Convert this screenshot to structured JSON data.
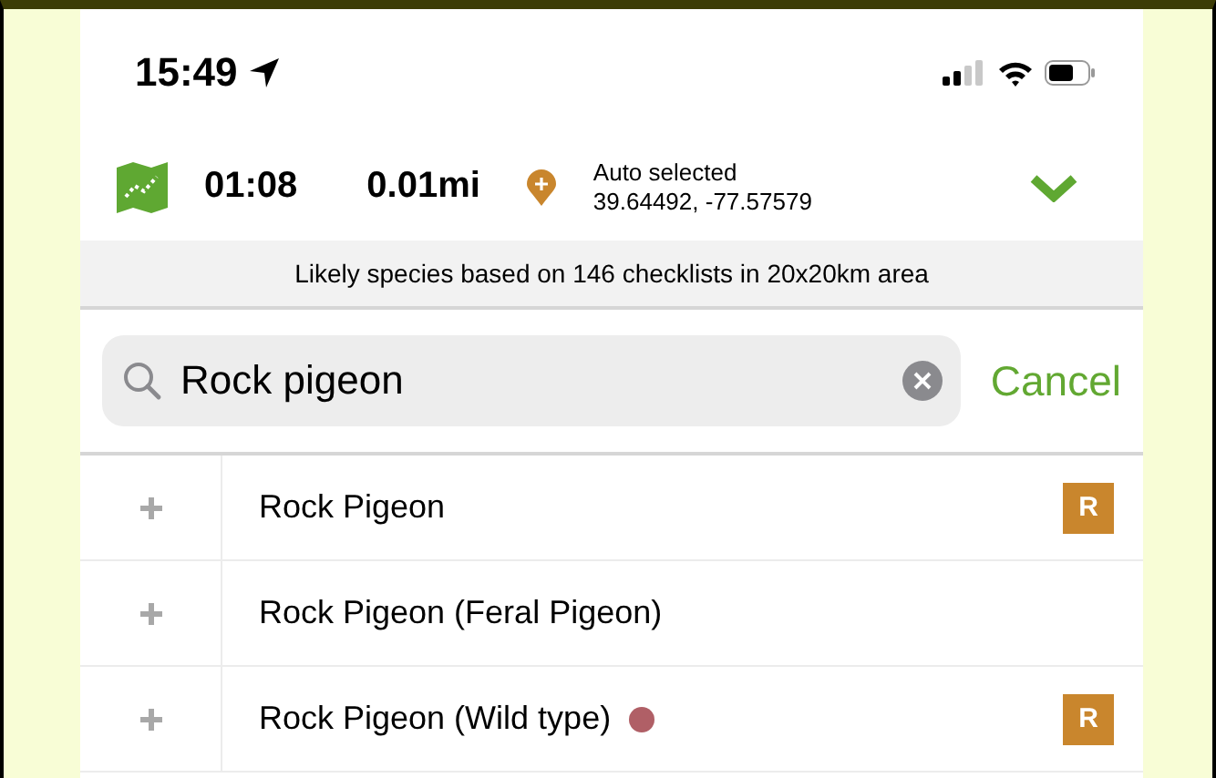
{
  "status_bar": {
    "time": "15:49"
  },
  "tracking": {
    "duration": "01:08",
    "distance": "0.01mi",
    "location_label": "Auto selected",
    "coordinates": "39.64492, -77.57579"
  },
  "banner": "Likely species based on 146 checklists in 20x20km area",
  "search": {
    "value": "Rock pigeon",
    "cancel": "Cancel"
  },
  "species": [
    {
      "name": "Rock Pigeon",
      "badge": "R"
    },
    {
      "name": "Rock Pigeon (Feral Pigeon)"
    },
    {
      "name": "Rock Pigeon (Wild type)",
      "color": "#b05f66",
      "badge": "R"
    }
  ]
}
